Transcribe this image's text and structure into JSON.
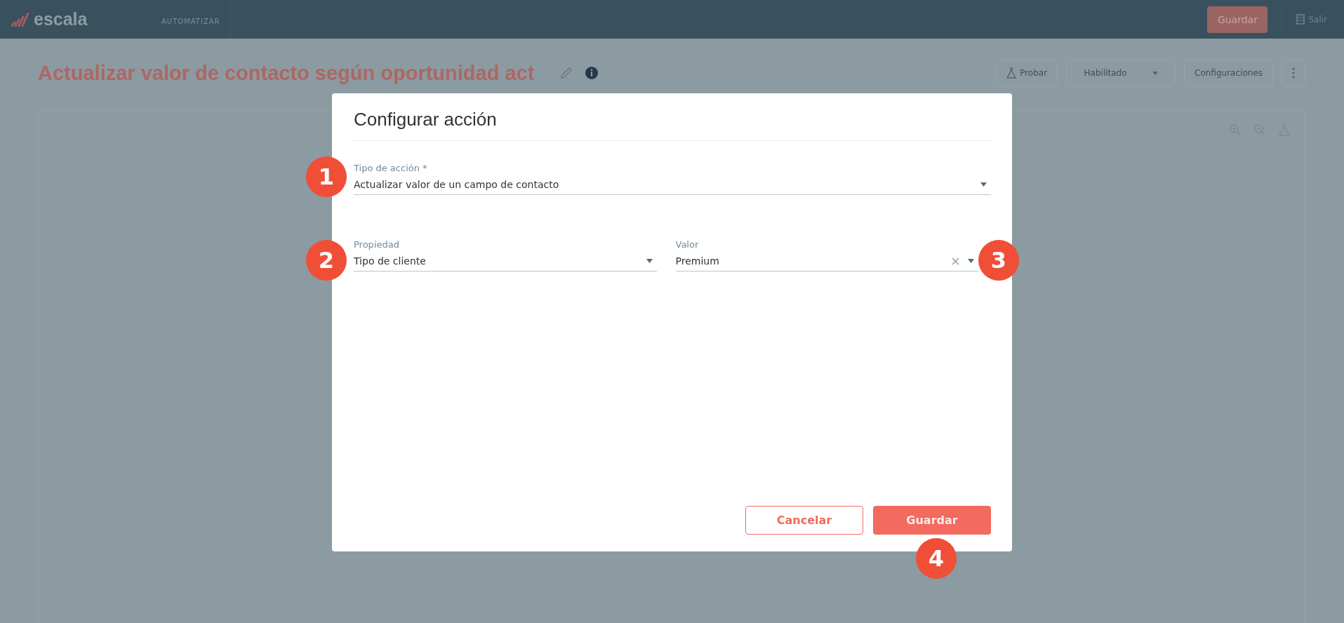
{
  "top_bar": {
    "logo_text": "escala",
    "section": "AUTOMATIZAR",
    "save_button": "Guardar",
    "exit_link": "Salir"
  },
  "page": {
    "title": "Actualizar valor de contacto según oportunidad act",
    "actions": [
      {
        "kind": "icon_text",
        "label": "Probar"
      },
      {
        "kind": "dropdown",
        "label": "Habilitado"
      },
      {
        "kind": "text",
        "label": "Configuraciones"
      },
      {
        "kind": "more"
      }
    ]
  },
  "dialog": {
    "title": "Configurar acción",
    "fields": [
      {
        "label": "Tipo de acción *",
        "value": "Actualizar valor de un campo de contacto",
        "clearable": false
      },
      {
        "label": "Propiedad",
        "value": "Tipo de cliente",
        "clearable": false
      },
      {
        "label": "Valor",
        "value": "Premium",
        "clearable": true
      }
    ],
    "buttons": [
      {
        "label": "Cancelar",
        "kind": "secondary"
      },
      {
        "label": "Guardar",
        "kind": "primary"
      }
    ]
  },
  "annotations": [
    "1",
    "2",
    "3",
    "4"
  ]
}
